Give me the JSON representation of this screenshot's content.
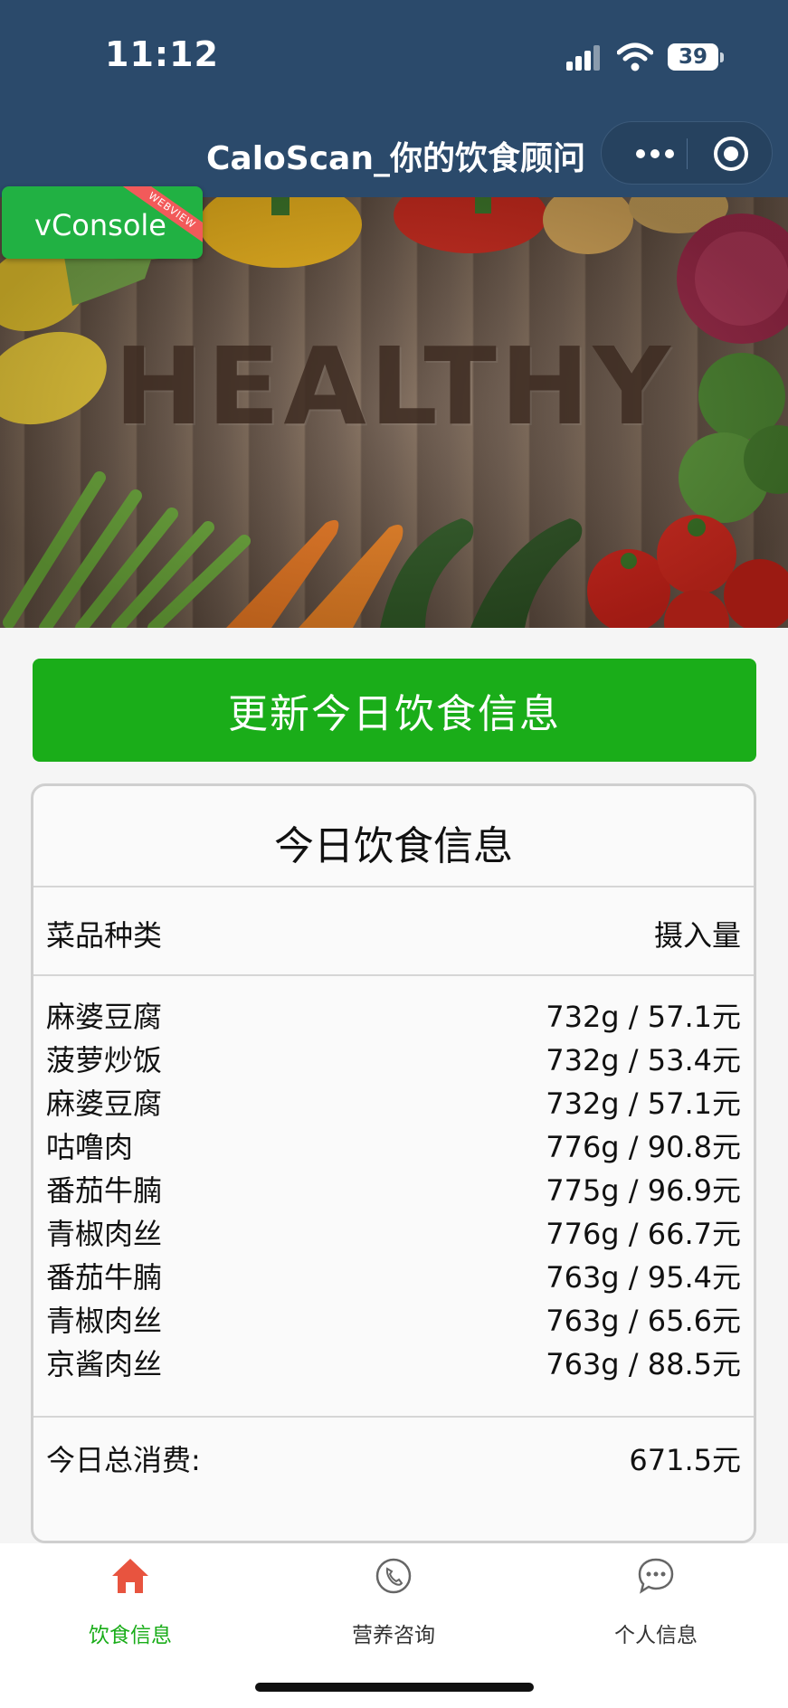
{
  "status_bar": {
    "time": "11:12",
    "battery": "39"
  },
  "nav": {
    "title": "CaloScan_你的饮食顾问"
  },
  "banner": {
    "word": "HEALTHY"
  },
  "vconsole": {
    "label": "vConsole",
    "ribbon": "WEBVIEW"
  },
  "actions": {
    "update_button": "更新今日饮食信息"
  },
  "card": {
    "title": "今日饮食信息",
    "col_dish": "菜品种类",
    "col_amount": "摄入量",
    "rows": [
      {
        "name": "麻婆豆腐",
        "amount": "732g / 57.1元"
      },
      {
        "name": "菠萝炒饭",
        "amount": "732g / 53.4元"
      },
      {
        "name": "麻婆豆腐",
        "amount": "732g / 57.1元"
      },
      {
        "name": "咕噜肉",
        "amount": "776g / 90.8元"
      },
      {
        "name": "番茄牛腩",
        "amount": "775g / 96.9元"
      },
      {
        "name": "青椒肉丝",
        "amount": "776g / 66.7元"
      },
      {
        "name": "番茄牛腩",
        "amount": "763g / 95.4元"
      },
      {
        "name": "青椒肉丝",
        "amount": "763g / 65.6元"
      },
      {
        "name": "京酱肉丝",
        "amount": "763g / 88.5元"
      }
    ],
    "total_label": "今日总消费:",
    "total_value": "671.5元"
  },
  "tabs": [
    {
      "label": "饮食信息",
      "icon": "home-icon",
      "active": true
    },
    {
      "label": "营养咨询",
      "icon": "phone-icon",
      "active": false
    },
    {
      "label": "个人信息",
      "icon": "chat-icon",
      "active": false
    }
  ],
  "colors": {
    "nav_bg": "#2b4a6b",
    "primary_green": "#1aad19",
    "active_tab_icon": "#e8543f"
  }
}
